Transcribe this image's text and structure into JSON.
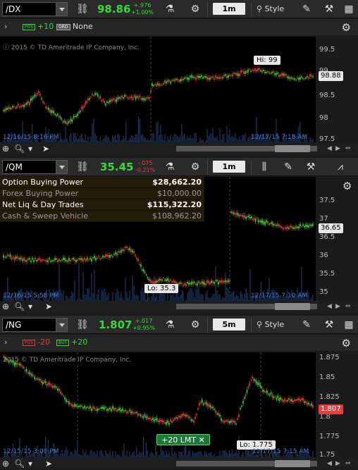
{
  "panels": [
    {
      "symbol": "/DX",
      "price": "98.86",
      "change": [
        "+.976",
        "+1.00%"
      ],
      "period": "1m",
      "style_label": "Style",
      "subbar": {
        "tag": "POS",
        "tag_value": "+10",
        "tag2": "ORD",
        "tag2_value": "None"
      },
      "copyright": "2015 © TD Ameritrade IP Company, Inc.",
      "y_ticks": [
        "99.5",
        "99",
        "98.5",
        "98",
        "97.5"
      ],
      "last_price": "98.88",
      "callout": "Hi: 99",
      "x_labels": [
        "12/16/15 8:16 PM",
        "12/17/15 7:18 AM"
      ]
    },
    {
      "symbol": "/QM",
      "price": "35.45",
      "change": [
        "-.075",
        "-0.21%"
      ],
      "period": "1m",
      "account": [
        {
          "label": "Option Buying Power",
          "value": "$28,662.20"
        },
        {
          "label": "Forex Buying Power",
          "value": "$10,000.00"
        },
        {
          "label": "Net Liq & Day Trades",
          "value": "$115,322.20"
        },
        {
          "label": "Cash & Sweep Vehicle",
          "value": "$108,962.20"
        }
      ],
      "y_ticks": [
        "37.5",
        "37",
        "36.5",
        "36",
        "35.5",
        "35"
      ],
      "last_price": "36.65",
      "callout": "Lo: 35.3",
      "x_labels": [
        "12/16/15 5:58 PM",
        "12/17/15 7:10 AM"
      ]
    },
    {
      "symbol": "/NG",
      "price": "1.807",
      "change": [
        "+.017",
        "+0.95%"
      ],
      "period": "5m",
      "style_label": "Style",
      "subbar": {
        "tag": "POS",
        "tag_value": "-20",
        "tag2": "BUY",
        "tag2_value": "+20"
      },
      "copyright": "2015 © TD Ameritrade IP Company, Inc.",
      "y_ticks": [
        "1.875",
        "1.85",
        "1.825",
        "1.8",
        "1.775",
        "1.75"
      ],
      "last_price": "1.807",
      "callout": "Lo: 1.775",
      "order_label": "+20 LMT",
      "x_labels": [
        "12/15/15 3:00 PM",
        "12/17/15 7:15 AM"
      ]
    }
  ],
  "colors": {
    "up": "#3ad83a",
    "down": "#e04040",
    "xlabel": "#4a78c8"
  }
}
